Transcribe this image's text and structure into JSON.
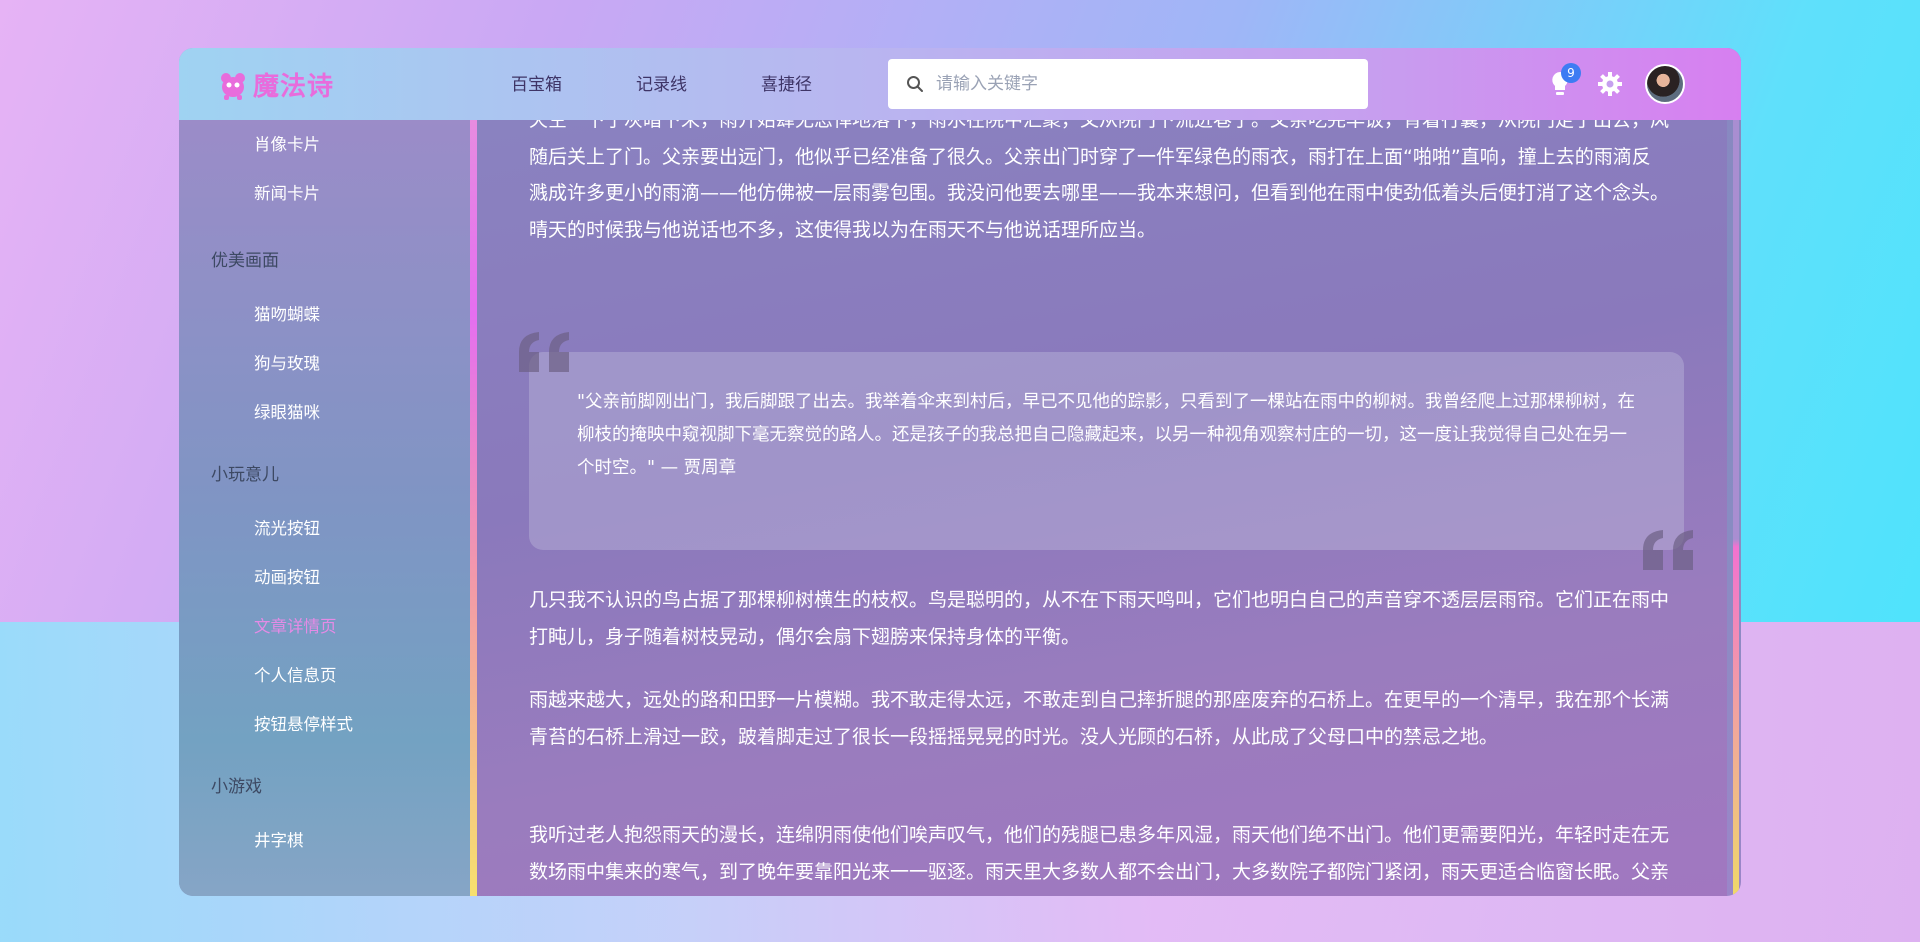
{
  "header": {
    "logo_text": "魔法诗",
    "nav": [
      "百宝箱",
      "记录线",
      "喜捷径"
    ],
    "search_placeholder": "请输入关键字",
    "notification_count": "9"
  },
  "sidebar": {
    "items_top": [
      "肖像卡片",
      "新闻卡片"
    ],
    "group_1": "优美画面",
    "items_1": [
      "猫吻蝴蝶",
      "狗与玫瑰",
      "绿眼猫咪"
    ],
    "group_2": "小玩意儿",
    "items_2": [
      "流光按钮",
      "动画按钮",
      "文章详情页",
      "个人信息页",
      "按钮悬停样式"
    ],
    "group_3": "小游戏",
    "items_3": [
      "井字棋"
    ],
    "active_item": "文章详情页"
  },
  "article": {
    "para_top": "天空一下子灰暗下来，雨开始肆无忌惮地落下，雨水在院中汇聚，又从院门下流进巷子。父亲吃完早饭，背着行囊，从院门走了出去，风随后关上了门。父亲要出远门，他似乎已经准备了很久。父亲出门时穿了一件军绿色的雨衣，雨打在上面“啪啪”直响，撞上去的雨滴反溅成许多更小的雨滴——他仿佛被一层雨雾包围。我没问他要去哪里——我本来想问，但看到他在雨中使劲低着头后便打消了这个念头。晴天的时候我与他说话也不多，这使得我以为在雨天不与他说话理所应当。",
    "quote": "\"父亲前脚刚出门，我后脚跟了出去。我举着伞来到村后，早已不见他的踪影，只看到了一棵站在雨中的柳树。我曾经爬上过那棵柳树，在柳枝的掩映中窥视脚下毫无察觉的路人。还是孩子的我总把自己隐藏起来，以另一种视角观察村庄的一切，这一度让我觉得自己处在另一个时空。\" — 贾周章",
    "para_1": "几只我不认识的鸟占据了那棵柳树横生的枝杈。鸟是聪明的，从不在下雨天鸣叫，它们也明白自己的声音穿不透层层雨帘。它们正在雨中打盹儿，身子随着树枝晃动，偶尔会扇下翅膀来保持身体的平衡。",
    "para_2": "雨越来越大，远处的路和田野一片模糊。我不敢走得太远，不敢走到自己摔折腿的那座废弃的石桥上。在更早的一个清早，我在那个长满青苔的石桥上滑过一跤，跛着脚走过了很长一段摇摇晃晃的时光。没人光顾的石桥，从此成了父母口中的禁忌之地。",
    "para_3": "我听过老人抱怨雨天的漫长，连绵阴雨使他们唉声叹气，他们的残腿已患多年风湿，雨天他们绝不出门。他们更需要阳光，年轻时走在无数场雨中集来的寒气，到了晚年要靠阳光来一一驱逐。雨天里大多数人都不会出门，大多数院子都院门紧闭，雨天更适合临窗长眠。父亲却在雨天出门了，雨路上没有留下他的脚印。"
  },
  "colors": {
    "logo": "#e86cdc",
    "active_item": "#e58be6",
    "badge": "#3d7cf3"
  }
}
